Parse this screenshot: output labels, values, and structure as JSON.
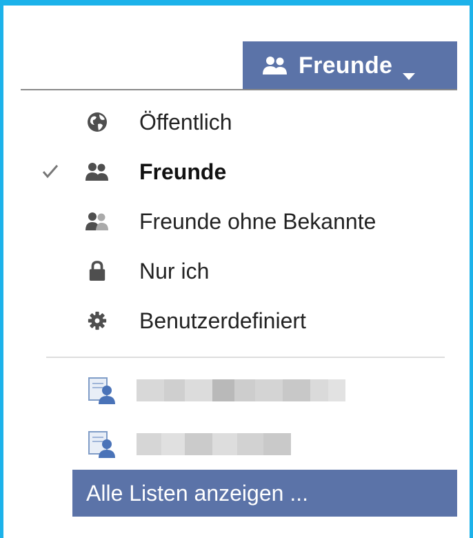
{
  "selector": {
    "label": "Freunde",
    "icon": "friends-icon",
    "caret_icon": "caret-down-icon"
  },
  "menu": {
    "items": [
      {
        "label": "Öffentlich",
        "icon": "globe-icon",
        "selected": false
      },
      {
        "label": "Freunde",
        "icon": "friends-icon",
        "selected": true
      },
      {
        "label": "Freunde ohne Bekannte",
        "icon": "friends-except-acquaintances-icon",
        "selected": false
      },
      {
        "label": "Nur ich",
        "icon": "lock-icon",
        "selected": false
      },
      {
        "label": "Benutzerdefiniert",
        "icon": "gear-icon",
        "selected": false
      }
    ],
    "lists": [
      {
        "icon": "friend-list-icon",
        "name_redacted": true
      },
      {
        "icon": "friend-list-icon",
        "name_redacted": true
      }
    ],
    "show_all_label": "Alle Listen anzeigen ..."
  },
  "colors": {
    "accent": "#5b73a8",
    "frame": "#1cb2ea",
    "icon": "#4f4f4f"
  }
}
